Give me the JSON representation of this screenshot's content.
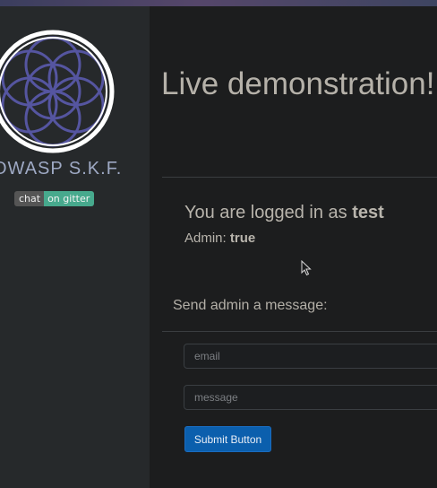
{
  "colors": {
    "accent": "#0b5fad",
    "badge_right": "#47a98d",
    "logo_ring": "#5555a0"
  },
  "sidebar": {
    "logo_icon": "flower-of-life-logo-icon",
    "brand": "OWASP S.K.F.",
    "badge": {
      "left": "chat",
      "right": "on gitter"
    }
  },
  "main": {
    "title": "Live demonstration!",
    "logged_prefix": "You are logged in as ",
    "username": "test",
    "admin_label": "Admin: ",
    "admin_value": "true",
    "send_label": "Send admin a message:",
    "form": {
      "email_placeholder": "email",
      "message_placeholder": "message",
      "submit_label": "Submit Button"
    }
  }
}
